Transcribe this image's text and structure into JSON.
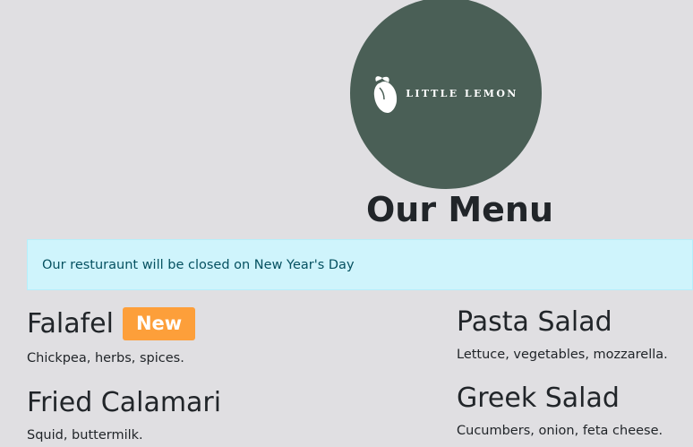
{
  "logo": {
    "text": "LITTLE LEMON",
    "icon": "lemon-icon",
    "circle_color": "#4a5f56"
  },
  "page_title": "Our Menu",
  "alert": {
    "message": "Our resturaunt will be closed on New Year's Day",
    "background": "#cff4fc",
    "text_color": "#055160"
  },
  "menu": {
    "items": [
      {
        "name": "Falafel",
        "badge": "New",
        "description": "Chickpea, herbs, spices."
      },
      {
        "name": "Fried Calamari",
        "description": "Squid, buttermilk."
      },
      {
        "name": "Pasta Salad",
        "description": "Lettuce, vegetables, mozzarella."
      },
      {
        "name": "Greek Salad",
        "description": "Cucumbers, onion, feta cheese."
      }
    ],
    "badge_color": "#fd9f3a"
  }
}
